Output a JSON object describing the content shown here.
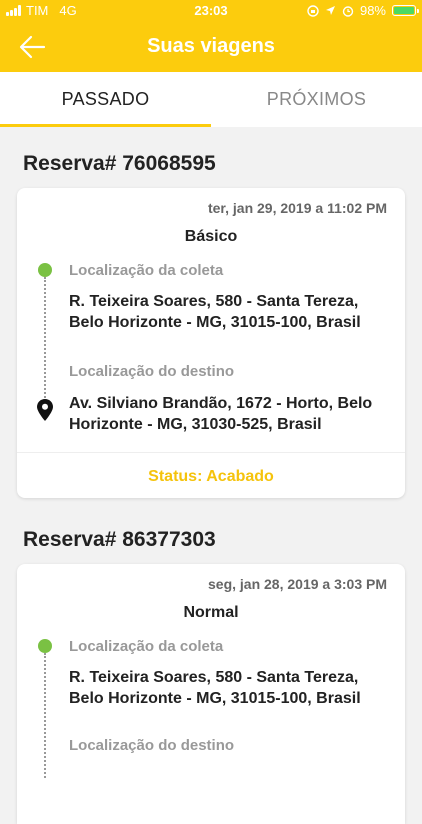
{
  "status_bar": {
    "carrier": "TIM",
    "network": "4G",
    "time": "23:03",
    "battery_percent": "98%",
    "battery_level": 0.98
  },
  "header": {
    "title": "Suas viagens"
  },
  "tabs": [
    {
      "label": "PASSADO",
      "active": true
    },
    {
      "label": "PRÓXIMOS",
      "active": false
    }
  ],
  "trips": [
    {
      "reservation": "Reserva# 76068595",
      "date": "ter, jan 29, 2019 a 11:02 PM",
      "vehicle": "Básico",
      "pickup_label": "Localização da coleta",
      "pickup_address": "R. Teixeira Soares, 580 - Santa Tereza, Belo Horizonte - MG, 31015-100, Brasil",
      "destination_label": "Localização do destino",
      "destination_address": "Av. Silviano Brandão, 1672 - Horto, Belo Horizonte - MG, 31030-525, Brasil",
      "status": "Status: Acabado"
    },
    {
      "reservation": "Reserva# 86377303",
      "date": "seg, jan 28, 2019 a 3:03 PM",
      "vehicle": "Normal",
      "pickup_label": "Localização da coleta",
      "pickup_address": "R. Teixeira Soares, 580 - Santa Tereza, Belo Horizonte - MG, 31015-100, Brasil",
      "destination_label": "Localização do destino"
    }
  ],
  "colors": {
    "accent": "#fccc0d",
    "pickup": "#7ac143",
    "status": "#f5c30c"
  }
}
